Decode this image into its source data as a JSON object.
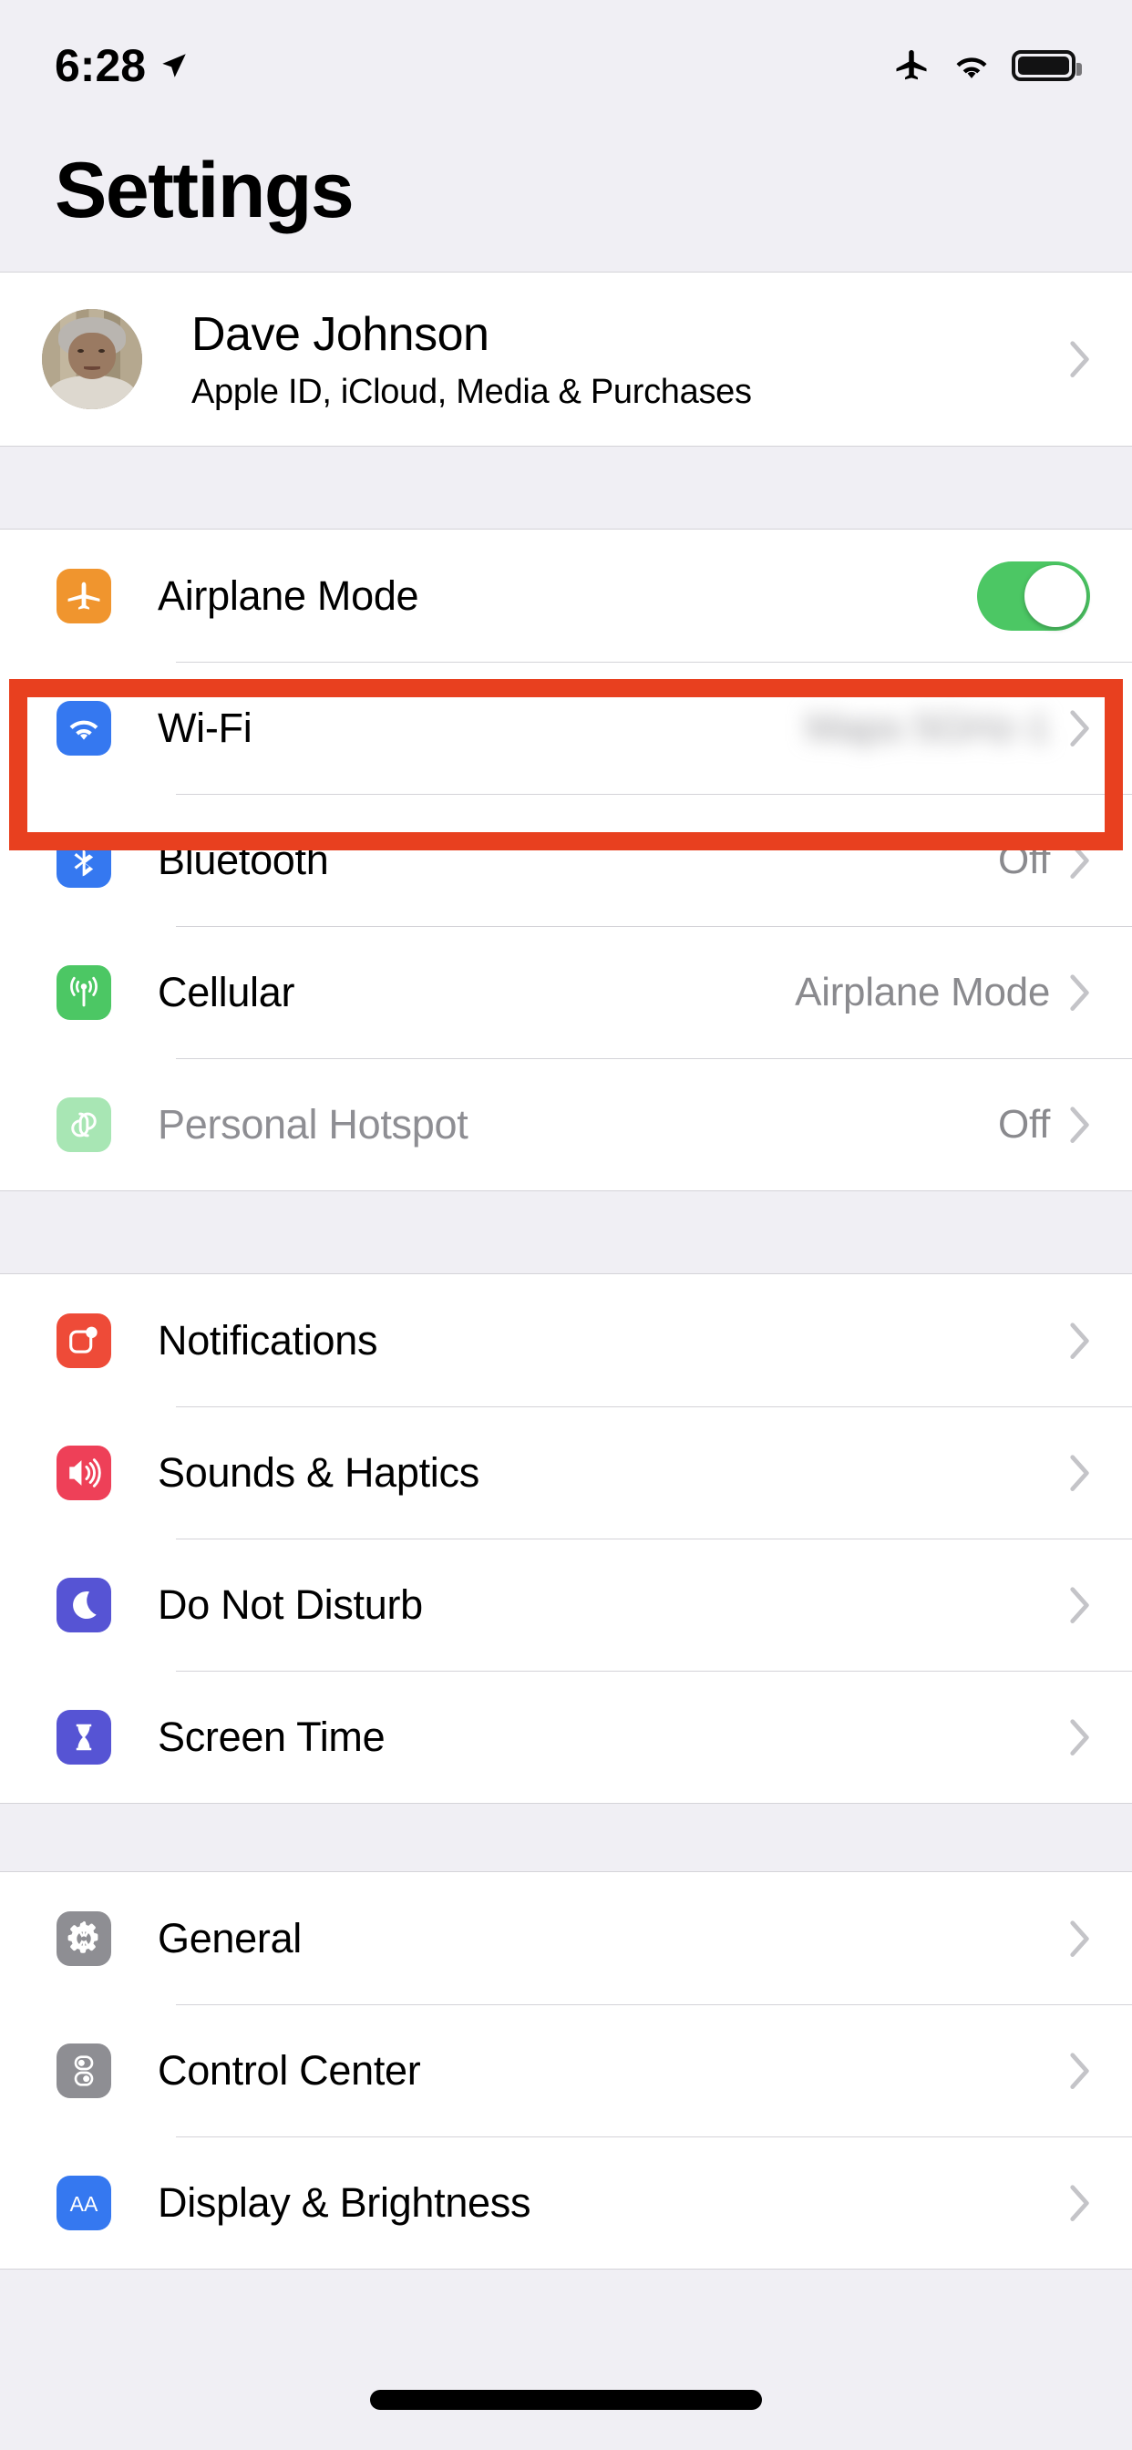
{
  "status_bar": {
    "time": "6:28",
    "icons": [
      "location-arrow-icon",
      "airplane-icon",
      "wifi-icon",
      "battery-full-icon"
    ]
  },
  "header": {
    "title": "Settings"
  },
  "profile": {
    "name": "Dave Johnson",
    "subtitle": "Apple ID, iCloud, Media & Purchases",
    "avatar_name": "profile-photo",
    "chevron": "chevron-right-icon"
  },
  "colors": {
    "highlight_border": "#E8401F",
    "toggle_on": "#4CC764",
    "icon_airplane": "#F0952E",
    "icon_wifi": "#3578F0",
    "icon_bluetooth": "#3578F0",
    "icon_cellular": "#4CC764",
    "icon_hotspot": "#A8E6B4",
    "icon_notifications": "#EE4B38",
    "icon_sounds": "#EE4058",
    "icon_dnd": "#5654D4",
    "icon_screentime": "#5654D4",
    "icon_general": "#8E8E93",
    "icon_controlcenter": "#8E8E93",
    "icon_display": "#3578F0",
    "page_bg": "#F0EFF4",
    "row_bg": "#FFFFFF",
    "separator": "#D4D3D8",
    "value_text": "#8A8A8E"
  },
  "groups": [
    {
      "name": "connectivity",
      "rows": [
        {
          "id": "airplane-mode",
          "label": "Airplane Mode",
          "icon": "airplane-icon",
          "control": "toggle",
          "toggle_on": true,
          "highlighted": true
        },
        {
          "id": "wifi",
          "label": "Wi-Fi",
          "icon": "wifi-icon",
          "control": "chevron",
          "value": "Maps 5GHz-1",
          "value_blurred": true
        },
        {
          "id": "bluetooth",
          "label": "Bluetooth",
          "icon": "bluetooth-icon",
          "control": "chevron",
          "value": "Off"
        },
        {
          "id": "cellular",
          "label": "Cellular",
          "icon": "cellular-icon",
          "control": "chevron",
          "value": "Airplane Mode"
        },
        {
          "id": "personal-hotspot",
          "label": "Personal Hotspot",
          "icon": "hotspot-icon",
          "control": "chevron",
          "value": "Off",
          "disabled": true
        }
      ]
    },
    {
      "name": "alerts",
      "rows": [
        {
          "id": "notifications",
          "label": "Notifications",
          "icon": "notifications-icon",
          "control": "chevron",
          "value": ""
        },
        {
          "id": "sounds-haptics",
          "label": "Sounds & Haptics",
          "icon": "speaker-icon",
          "control": "chevron",
          "value": ""
        },
        {
          "id": "do-not-disturb",
          "label": "Do Not Disturb",
          "icon": "moon-icon",
          "control": "chevron",
          "value": ""
        },
        {
          "id": "screen-time",
          "label": "Screen Time",
          "icon": "hourglass-icon",
          "control": "chevron",
          "value": ""
        }
      ]
    },
    {
      "name": "system",
      "rows": [
        {
          "id": "general",
          "label": "General",
          "icon": "gear-icon",
          "control": "chevron",
          "value": ""
        },
        {
          "id": "control-center",
          "label": "Control Center",
          "icon": "switches-icon",
          "control": "chevron",
          "value": ""
        },
        {
          "id": "display-brightness",
          "label": "Display & Brightness",
          "icon": "aa-text-icon",
          "control": "chevron",
          "value": ""
        }
      ]
    }
  ]
}
